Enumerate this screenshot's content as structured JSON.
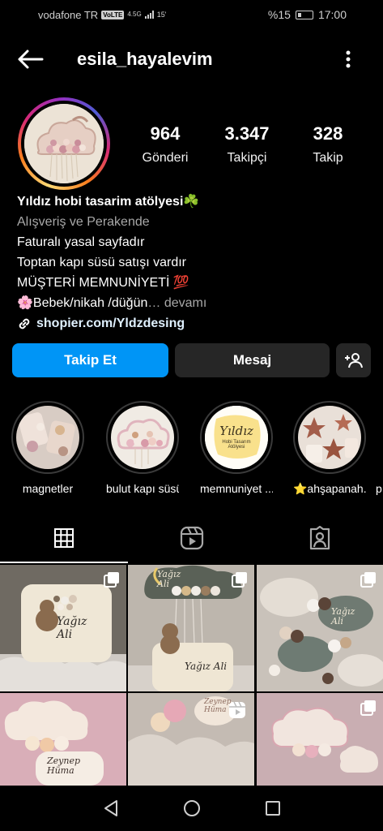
{
  "status_bar": {
    "carrier": "vodafone TR",
    "volte": "VoLTE",
    "network": "4.5G",
    "speed": "15'",
    "battery": "%15",
    "time": "17:00"
  },
  "header": {
    "username": "esila_hayalevim"
  },
  "stats": {
    "posts_count": "964",
    "posts_label": "Gönderi",
    "followers_count": "3.347",
    "followers_label": "Takipçi",
    "following_count": "328",
    "following_label": "Takip"
  },
  "bio": {
    "name": "Yıldız hobi  tasarim atölyesi☘️",
    "category": "Alışveriş ve Perakende",
    "line1": "Faturalı yasal sayfadır",
    "line2": "Toptan kapı süsü satışı vardır",
    "line3": "MÜŞTERİ MEMNUNİYETİ 💯",
    "line4": "🌸Bebek/nikah /düğün",
    "more": "… devamı",
    "link": "shopier.com/Yldzdesing"
  },
  "buttons": {
    "follow": "Takip Et",
    "message": "Mesaj"
  },
  "highlights": [
    {
      "label": "magnetler"
    },
    {
      "label": "bulut kapı süsü"
    },
    {
      "label": "memnuniyet ..."
    },
    {
      "label": "⭐ahşapanah..."
    },
    {
      "label": "p"
    }
  ],
  "highlight_yildiz": {
    "title": "Yıldız",
    "subtitle1": "Hobi Tasarım",
    "subtitle2": "Atölyesi"
  },
  "grid_text": {
    "cell1": "Yağız Ali",
    "cell2_top": "Yağız",
    "cell2_top2": "Ali",
    "cell2_bottom": "Yağız Ali",
    "cell3": "Yağız Ali",
    "cell4": "Zeynep Hüma",
    "cell5": "Zeynep Hüma"
  },
  "colors": {
    "follow_button": "#0095f6",
    "secondary_button": "#262626",
    "background": "#000000"
  },
  "icons": {
    "back": "arrow-left-icon",
    "more": "more-vertical-icon",
    "add_person": "add-person-icon",
    "grid_tab": "grid-icon",
    "reels_tab": "reels-icon",
    "tagged_tab": "tagged-icon",
    "multi_post": "carousel-icon",
    "reel_badge": "reels-icon",
    "link": "link-icon"
  }
}
